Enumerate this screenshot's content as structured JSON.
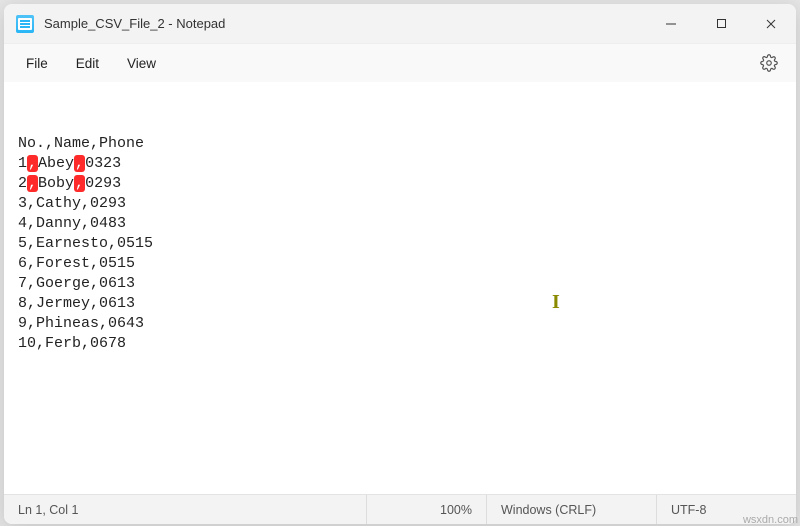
{
  "titlebar": {
    "title": "Sample_CSV_File_2 - Notepad"
  },
  "menu": {
    "file": "File",
    "edit": "Edit",
    "view": "View"
  },
  "lines": [
    "No.,Name,Phone",
    "1,Abey,0323",
    "2,Boby,0293",
    "3,Cathy,0293",
    "4,Danny,0483",
    "5,Earnesto,0515",
    "6,Forest,0515",
    "7,Goerge,0613",
    "8,Jermey,0613",
    "9,Phineas,0643",
    "10,Ferb,0678"
  ],
  "highlights": [
    {
      "line": 1,
      "cols": [
        1,
        6
      ]
    },
    {
      "line": 2,
      "cols": [
        1,
        6
      ]
    }
  ],
  "status": {
    "position": "Ln 1, Col 1",
    "zoom": "100%",
    "eol": "Windows (CRLF)",
    "encoding": "UTF-8"
  },
  "watermark": "wsxdn.com"
}
